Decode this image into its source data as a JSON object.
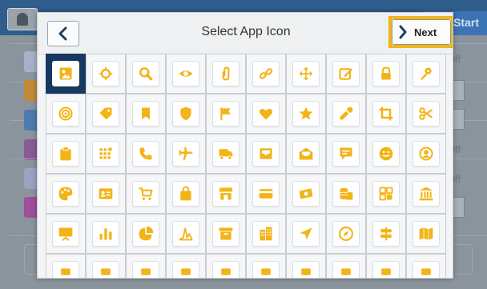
{
  "background": {
    "start_label": "Start",
    "off_labels": [
      "Off",
      "Off",
      "Off"
    ]
  },
  "dialog": {
    "title": "Select App Icon",
    "next_label": "Next",
    "accent_color": "#f2b416",
    "selected_color": "#17385f"
  },
  "icons": [
    [
      "photo-icon",
      "crosshair-icon",
      "search-icon",
      "eye-icon",
      "paperclip-icon",
      "link-icon",
      "move-arrows-icon",
      "edit-icon",
      "lock-icon",
      "key-icon"
    ],
    [
      "target-icon",
      "tag-icon",
      "bookmark-icon",
      "shield-icon",
      "flag-icon",
      "heart-icon",
      "star-icon",
      "dropper-icon",
      "crop-icon",
      "scissors-icon"
    ],
    [
      "clipboard-icon",
      "dot-grid-icon",
      "phone-icon",
      "airplane-icon",
      "truck-icon",
      "inbox-icon",
      "open-mail-icon",
      "chat-icon",
      "smiley-icon",
      "user-circle-icon"
    ],
    [
      "palette-icon",
      "id-card-icon",
      "cart-icon",
      "shopping-bag-icon",
      "storefront-icon",
      "credit-card-icon",
      "banknote-icon",
      "coins-icon",
      "apps-grid-icon",
      "bank-icon"
    ],
    [
      "presentation-icon",
      "bar-chart-icon",
      "pie-chart-icon",
      "line-chart-icon",
      "archive-box-icon",
      "building-icon",
      "send-arrow-icon",
      "compass-icon",
      "signpost-icon",
      "map-icon"
    ],
    [
      "partial-icon-1",
      "partial-icon-2",
      "partial-icon-3",
      "partial-icon-4",
      "partial-icon-5",
      "partial-icon-6",
      "partial-icon-7",
      "partial-icon-8",
      "partial-icon-9",
      "partial-icon-10"
    ]
  ]
}
